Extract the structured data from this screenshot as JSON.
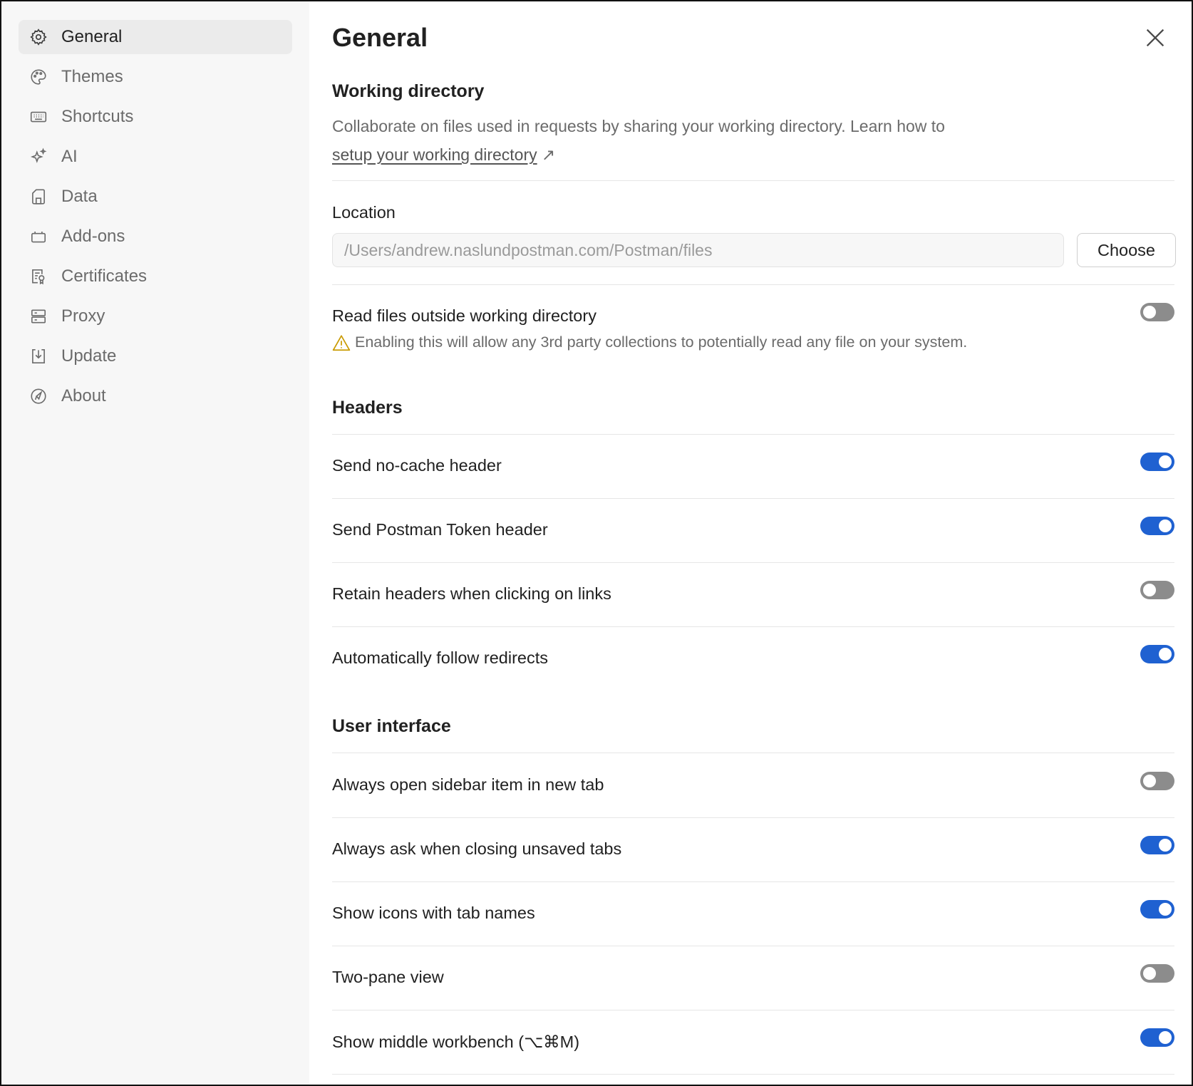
{
  "sidebar": {
    "items": [
      {
        "label": "General",
        "icon": "gear-icon"
      },
      {
        "label": "Themes",
        "icon": "palette-icon"
      },
      {
        "label": "Shortcuts",
        "icon": "keyboard-icon"
      },
      {
        "label": "AI",
        "icon": "sparkle-icon"
      },
      {
        "label": "Data",
        "icon": "sd-card-icon"
      },
      {
        "label": "Add-ons",
        "icon": "package-icon"
      },
      {
        "label": "Certificates",
        "icon": "certificate-icon"
      },
      {
        "label": "Proxy",
        "icon": "server-icon"
      },
      {
        "label": "Update",
        "icon": "download-icon"
      },
      {
        "label": "About",
        "icon": "postman-logo-icon"
      }
    ],
    "active": "General"
  },
  "main": {
    "title": "General",
    "working_directory": {
      "title": "Working directory",
      "desc_prefix": "Collaborate on files used in requests by sharing your working directory. Learn how to ",
      "link_text": "setup your working directory",
      "link_arrow": "↗",
      "location_label": "Location",
      "location_value": "/Users/andrew.naslundpostman.com/Postman/files",
      "choose_label": "Choose",
      "read_outside_label": "Read files outside working directory",
      "read_outside_on": false,
      "warning": "Enabling this will allow any 3rd party collections to potentially read any file on your system."
    },
    "headers": {
      "title": "Headers",
      "items": [
        {
          "label": "Send no-cache header",
          "on": true
        },
        {
          "label": "Send Postman Token header",
          "on": true
        },
        {
          "label": "Retain headers when clicking on links",
          "on": false
        },
        {
          "label": "Automatically follow redirects",
          "on": true
        }
      ]
    },
    "user_interface": {
      "title": "User interface",
      "items": [
        {
          "label": "Always open sidebar item in new tab",
          "on": false
        },
        {
          "label": "Always ask when closing unsaved tabs",
          "on": true
        },
        {
          "label": "Show icons with tab names",
          "on": true
        },
        {
          "label": "Two-pane view",
          "on": false
        },
        {
          "label": "Show middle workbench (⌥⌘M)",
          "on": true
        }
      ]
    }
  },
  "colors": {
    "toggle_on": "#1f61d1",
    "toggle_off": "#8c8c8c",
    "warning": "#c99a00"
  }
}
